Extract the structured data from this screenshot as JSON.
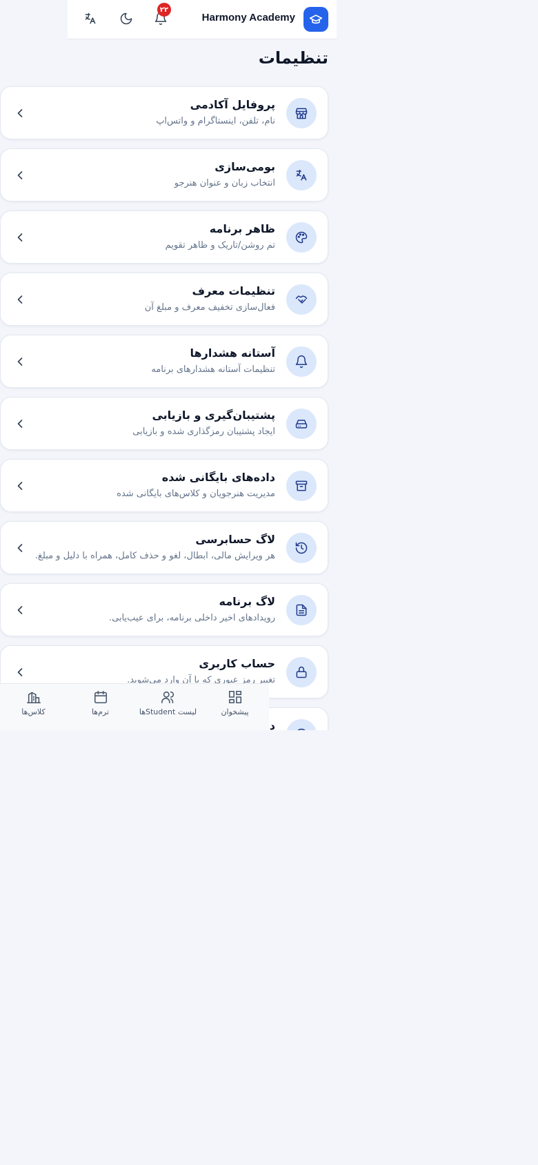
{
  "header": {
    "app_name": "Harmony Academy",
    "notification_count": "۲۲"
  },
  "page": {
    "title": "تنظیمات"
  },
  "settings": [
    {
      "title": "پروفایل آکادمی",
      "subtitle": "نام، تلفن، اینستاگرام و واتس‌اپ",
      "icon": "store-icon"
    },
    {
      "title": "بومی‌سازی",
      "subtitle": "انتخاب زبان و عنوان هنرجو",
      "icon": "translate-icon"
    },
    {
      "title": "ظاهر برنامه",
      "subtitle": "تم روشن/تاریک و ظاهر تقویم",
      "icon": "palette-icon"
    },
    {
      "title": "تنظیمات معرف",
      "subtitle": "فعال‌سازی تخفیف معرف و مبلغ آن",
      "icon": "handshake-icon"
    },
    {
      "title": "آستانه هشدارها",
      "subtitle": "تنظیمات آستانه هشدارهای برنامه",
      "icon": "bell-icon"
    },
    {
      "title": "پشتیبان‌گیری و بازیابی",
      "subtitle": "ایجاد پشتیبان رمزگذاری شده و بازیابی",
      "icon": "hard-drive-icon"
    },
    {
      "title": "داده‌های بایگانی شده",
      "subtitle": "مدیریت هنرجویان و کلاس‌های بایگانی شده",
      "icon": "archive-icon"
    },
    {
      "title": "لاگ حسابرسی",
      "subtitle": "هر ویرایش مالی، ابطال، لغو و حذف کامل، همراه با دلیل و مبلغ.",
      "icon": "history-icon"
    },
    {
      "title": "لاگ برنامه",
      "subtitle": "رویدادهای اخیر داخلی برنامه، برای عیب‌یابی.",
      "icon": "file-text-icon"
    },
    {
      "title": "حساب کاربری",
      "subtitle": "تغییر رمز عبوری که با آن وارد می‌شوید.",
      "icon": "lock-icon"
    },
    {
      "title": "د",
      "subtitle": "",
      "icon": "info-icon"
    }
  ],
  "bottom_nav": [
    {
      "label": "پیشخوان",
      "icon": "dashboard-icon"
    },
    {
      "label": "لیست Studentها",
      "icon": "users-icon"
    },
    {
      "label": "ترم‌ها",
      "icon": "calendar-icon"
    },
    {
      "label": "کلاس‌ها",
      "icon": "building-icon"
    }
  ],
  "colors": {
    "accent": "#2563eb",
    "icon_bg": "#dbe7fb",
    "icon_fg": "#1e3a8a",
    "badge": "#dc2626"
  }
}
